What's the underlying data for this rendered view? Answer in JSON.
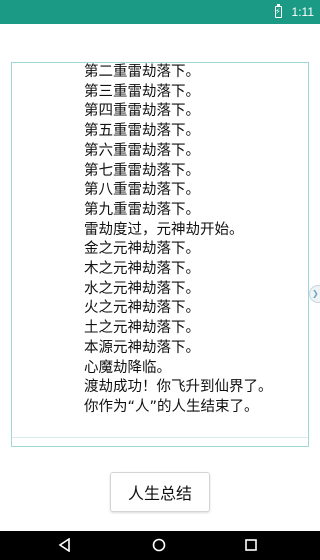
{
  "status_bar": {
    "time": "1:11",
    "battery_icon": "battery-charging-icon"
  },
  "log": {
    "lines": [
      "第二重雷劫落下。",
      "第三重雷劫落下。",
      "第四重雷劫落下。",
      "第五重雷劫落下。",
      "第六重雷劫落下。",
      "第七重雷劫落下。",
      "第八重雷劫落下。",
      "第九重雷劫落下。",
      "雷劫度过，元神劫开始。",
      "金之元神劫落下。",
      "木之元神劫落下。",
      "水之元神劫落下。",
      "火之元神劫落下。",
      "土之元神劫落下。",
      "本源元神劫落下。",
      "心魔劫降临。",
      "渡劫成功！你飞升到仙界了。",
      "你作为“人”的人生结束了。"
    ]
  },
  "button": {
    "label": "人生总结"
  },
  "nav": {
    "back_icon": "back-triangle-icon",
    "home_icon": "home-circle-icon",
    "recent_icon": "recent-square-icon"
  },
  "colors": {
    "status_bar": "#1b9b86",
    "log_border": "#9fd8dc",
    "nav_bar": "#000000"
  }
}
